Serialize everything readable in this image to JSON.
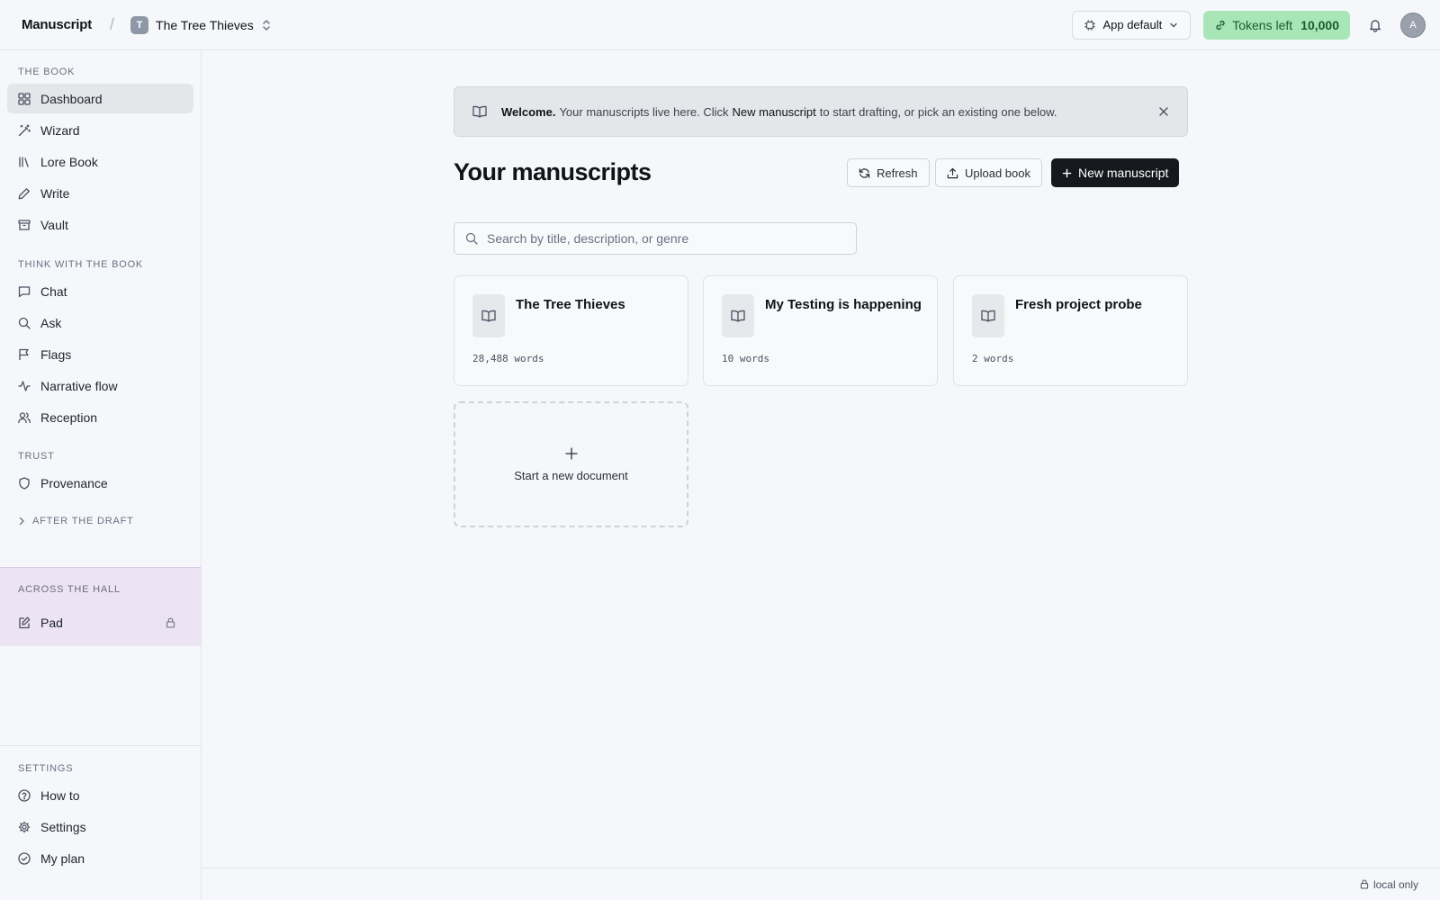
{
  "topbar": {
    "brand": "Manuscript",
    "separator": "/",
    "project_initial": "T",
    "project_name": "The Tree Thieves",
    "model_selector": "App default",
    "tokens_label": "Tokens left",
    "tokens_value": "10,000",
    "avatar_initial": "A"
  },
  "sidebar": {
    "section_book": "THE BOOK",
    "section_think": "THINK WITH THE BOOK",
    "section_trust": "TRUST",
    "section_after": "AFTER THE DRAFT",
    "section_across": "ACROSS THE HALL",
    "section_settings": "SETTINGS",
    "items": {
      "dashboard": "Dashboard",
      "wizard": "Wizard",
      "lore_book": "Lore Book",
      "write": "Write",
      "vault": "Vault",
      "chat": "Chat",
      "ask": "Ask",
      "flags": "Flags",
      "narrative_flow": "Narrative flow",
      "reception": "Reception",
      "provenance": "Provenance",
      "pad": "Pad",
      "how_to": "How to",
      "settings": "Settings",
      "my_plan": "My plan"
    }
  },
  "welcome": {
    "bold": "Welcome.",
    "text_before": "Your manuscripts live here. Click",
    "link": "New manuscript",
    "text_after": "to start drafting, or pick an existing one below."
  },
  "main": {
    "title": "Your manuscripts",
    "refresh_label": "Refresh",
    "upload_label": "Upload book",
    "new_label": "New manuscript",
    "search_placeholder": "Search by title, description, or genre",
    "new_document_label": "Start a new document"
  },
  "manuscripts": [
    {
      "title": "The Tree Thieves",
      "words": "28,488 words"
    },
    {
      "title": "My Testing is happening",
      "words": "10 words"
    },
    {
      "title": "Fresh project probe",
      "words": "2 words"
    }
  ],
  "footer": {
    "status": "local only"
  },
  "colors": {
    "accent_dark": "#16181d",
    "tokens_bg": "#a8e6b8",
    "across_bg": "#ece3f3"
  }
}
